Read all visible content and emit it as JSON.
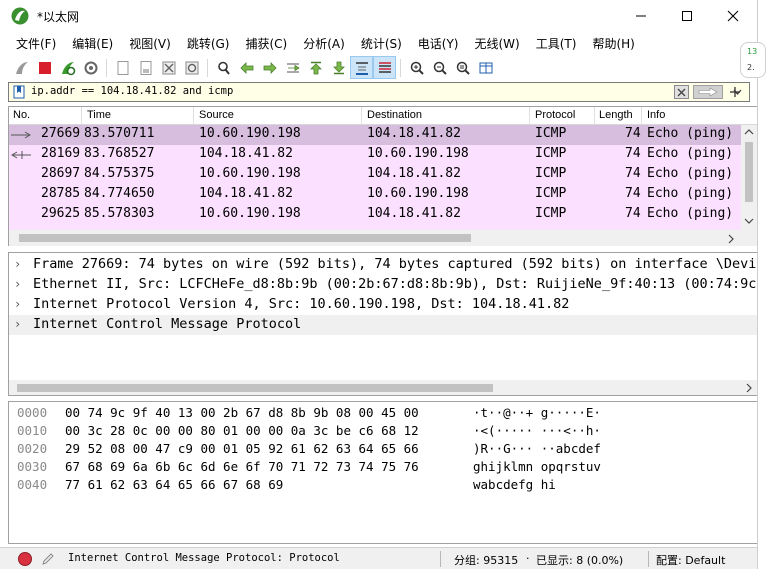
{
  "window": {
    "title": "*以太网"
  },
  "menu": [
    "文件(F)",
    "编辑(E)",
    "视图(V)",
    "跳转(G)",
    "捕获(C)",
    "分析(A)",
    "统计(S)",
    "电话(Y)",
    "无线(W)",
    "工具(T)",
    "帮助(H)"
  ],
  "toolbar_icons": [
    "shark-fin-start-icon",
    "stop-capture-icon",
    "restart-capture-icon",
    "capture-options-icon",
    "open-file-icon",
    "save-file-icon",
    "close-file-icon",
    "reload-file-icon",
    "find-packet-icon",
    "go-back-icon",
    "go-forward-icon",
    "go-to-packet-icon",
    "go-first-icon",
    "go-last-icon",
    "autoscroll-icon",
    "colorize-icon",
    "zoom-in-icon",
    "zoom-out-icon",
    "zoom-normal-icon",
    "resize-columns-icon"
  ],
  "filter": {
    "value": "ip.addr == 104.18.41.82 and icmp"
  },
  "packet_list": {
    "columns": [
      "No.",
      "Time",
      "Source",
      "Destination",
      "Protocol",
      "Length",
      "Info"
    ],
    "rows": [
      {
        "no": "27669",
        "time": "83.570711",
        "source": "10.60.190.198",
        "destination": "104.18.41.82",
        "protocol": "ICMP",
        "length": "74",
        "info": "Echo (ping)",
        "selected": true
      },
      {
        "no": "28169",
        "time": "83.768527",
        "source": "104.18.41.82",
        "destination": "10.60.190.198",
        "protocol": "ICMP",
        "length": "74",
        "info": "Echo (ping)",
        "selected": false
      },
      {
        "no": "28697",
        "time": "84.575375",
        "source": "10.60.190.198",
        "destination": "104.18.41.82",
        "protocol": "ICMP",
        "length": "74",
        "info": "Echo (ping)",
        "selected": false
      },
      {
        "no": "28785",
        "time": "84.774650",
        "source": "104.18.41.82",
        "destination": "10.60.190.198",
        "protocol": "ICMP",
        "length": "74",
        "info": "Echo (ping)",
        "selected": false
      },
      {
        "no": "29625",
        "time": "85.578303",
        "source": "10.60.190.198",
        "destination": "104.18.41.82",
        "protocol": "ICMP",
        "length": "74",
        "info": "Echo (ping)",
        "selected": false
      }
    ]
  },
  "details": [
    "Frame 27669: 74 bytes on wire (592 bits), 74 bytes captured (592 bits) on interface \\Device",
    "Ethernet II, Src: LCFCHeFe_d8:8b:9b (00:2b:67:d8:8b:9b), Dst: RuijieNe_9f:40:13 (00:74:9c:9",
    "Internet Protocol Version 4, Src: 10.60.190.198, Dst: 104.18.41.82",
    "Internet Control Message Protocol"
  ],
  "bytes": [
    {
      "offset": "0000",
      "hex": "00 74 9c 9f 40 13 00 2b  67 d8 8b 9b 08 00 45 00",
      "ascii": "·t··@··+ g·····E·"
    },
    {
      "offset": "0010",
      "hex": "00 3c 28 0c 00 00 80 01  00 00 0a 3c be c6 68 12",
      "ascii": "·<(····· ···<··h·"
    },
    {
      "offset": "0020",
      "hex": "29 52 08 00 47 c9 00 01  05 92 61 62 63 64 65 66",
      "ascii": ")R··G··· ··abcdef"
    },
    {
      "offset": "0030",
      "hex": "67 68 69 6a 6b 6c 6d 6e  6f 70 71 72 73 74 75 76",
      "ascii": "ghijklmn opqrstuv"
    },
    {
      "offset": "0040",
      "hex": "77 61 62 63 64 65 66 67  68 69",
      "ascii": "wabcdefg hi"
    }
  ],
  "status": {
    "message": "Internet Control Message Protocol: Protocol",
    "packets": "分组: 95315",
    "displayed": "已显示: 8 (0.0%)",
    "profile": "配置: Default"
  },
  "side": {
    "badge_top": "13",
    "badge_bottom": "2."
  },
  "colors": {
    "selected_row": "#d7bedf",
    "icmp_row": "#fce0ff",
    "filter_bg": "#ffffe8",
    "status_error": "#d9313f"
  }
}
